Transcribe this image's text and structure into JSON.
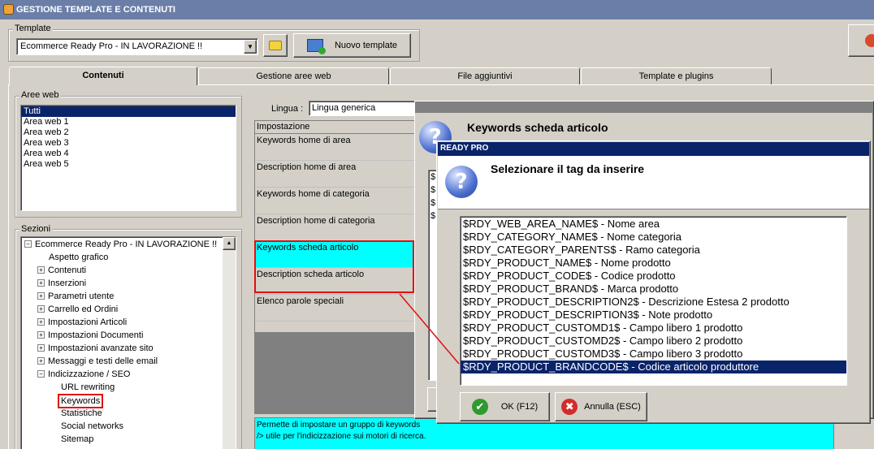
{
  "window": {
    "title": "GESTIONE TEMPLATE E CONTENUTI"
  },
  "template": {
    "group_label": "Template",
    "selected": "Ecommerce Ready Pro - IN LAVORAZIONE !!",
    "new_button": "Nuovo template"
  },
  "tabs": [
    {
      "label": "Contenuti"
    },
    {
      "label": "Gestione aree web"
    },
    {
      "label": "File aggiuntivi"
    },
    {
      "label": "Template e plugins"
    }
  ],
  "aree_web": {
    "group_label": "Aree web",
    "items": [
      "Tutti",
      "Area web 1",
      "Area web 2",
      "Area web 3",
      "Area web 4",
      "Area web 5"
    ]
  },
  "sezioni": {
    "group_label": "Sezioni",
    "root": "Ecommerce Ready Pro - IN LAVORAZIONE !!",
    "nodes": [
      "Aspetto grafico",
      "Contenuti",
      "Inserzioni",
      "Parametri utente",
      "Carrello ed Ordini",
      "Impostazioni Articoli",
      "Impostazioni Documenti",
      "Impostazioni avanzate sito",
      "Messaggi e testi delle email",
      "Indicizzazione / SEO"
    ],
    "seo_children": [
      "URL rewriting",
      "Keywords",
      "Statistiche",
      "Social networks",
      "Sitemap"
    ]
  },
  "lingua": {
    "label": "Lingua :",
    "value": "Lingua generica"
  },
  "grid": {
    "header": "Impostazione",
    "rows": [
      "Keywords home di area",
      "Description home di area",
      "Keywords home di categoria",
      "Description home di categoria",
      "Keywords scheda articolo",
      "Description scheda articolo",
      "Elenco parole speciali"
    ]
  },
  "info_text": {
    "line1": "Permette di impostare un gruppo di keywords",
    "line2": "/> utile per l'indicizzazione sui motori di ricerca."
  },
  "outer_dialog": {
    "title": "Keywords scheda articolo",
    "text_prefix": "$"
  },
  "inner_dialog": {
    "titlebar": "READY PRO",
    "heading": "Selezionare il tag da inserire",
    "tags": [
      "$RDY_WEB_AREA_NAME$ - Nome area",
      "$RDY_CATEGORY_NAME$ - Nome categoria",
      "$RDY_CATEGORY_PARENTS$ - Ramo categoria",
      "$RDY_PRODUCT_NAME$ - Nome prodotto",
      "$RDY_PRODUCT_CODE$ - Codice prodotto",
      "$RDY_PRODUCT_BRAND$ - Marca prodotto",
      "$RDY_PRODUCT_DESCRIPTION2$ - Descrizione Estesa 2 prodotto",
      "$RDY_PRODUCT_DESCRIPTION3$ - Note prodotto",
      "$RDY_PRODUCT_CUSTOMD1$ - Campo libero 1 prodotto",
      "$RDY_PRODUCT_CUSTOMD2$ - Campo libero 2 prodotto",
      "$RDY_PRODUCT_CUSTOMD3$ - Campo libero 3 prodotto",
      "$RDY_PRODUCT_BRANDCODE$ - Codice articolo produttore"
    ],
    "ok_label": "OK (F12)",
    "cancel_label": "Annulla (ESC)"
  },
  "colors": {
    "highlight": "#0a246a",
    "cyan": "#00ffff",
    "annotation": "#e01010"
  }
}
